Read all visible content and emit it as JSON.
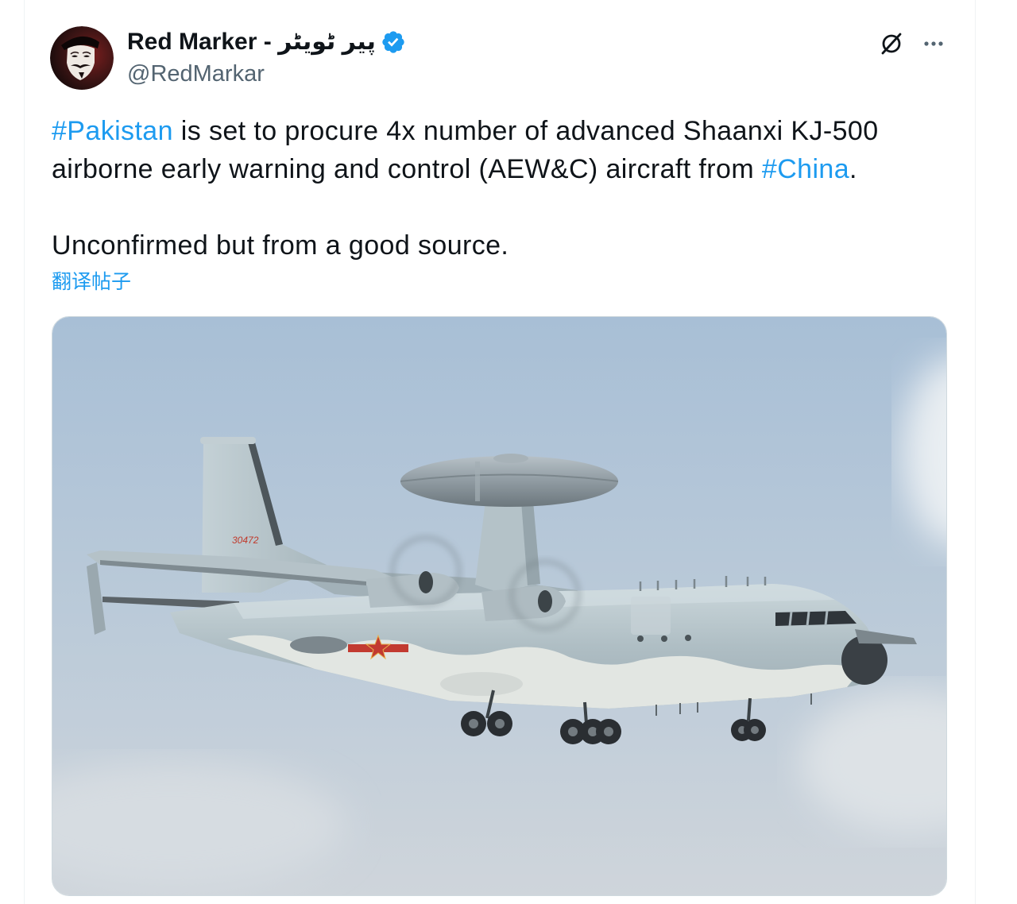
{
  "tweet": {
    "author": {
      "display_name": "Red Marker - پیر ٹویٹر",
      "handle": "@RedMarkar",
      "verified": true
    },
    "hashtag_1": "#Pakistan",
    "line_1_text": " is set to procure 4x number of advanced Shaanxi KJ-500",
    "line_2_text": "airborne early warning and control (AEW&C) aircraft from ",
    "hashtag_2": "#China",
    "line_2_end": ".",
    "paragraph_2": "Unconfirmed but from a good source.",
    "translate_label": "翻译帖子"
  },
  "media": {
    "tail_number": "30472"
  },
  "icons": {
    "avatar": "avatar-image",
    "verified": "verified-badge-icon",
    "grok": "grok-icon",
    "more": "more-icon"
  },
  "colors": {
    "text": "#0f1419",
    "secondary_text": "#536471",
    "link": "#1d9bf0",
    "verified": "#1d9bf0",
    "divider": "#eff3f4"
  }
}
